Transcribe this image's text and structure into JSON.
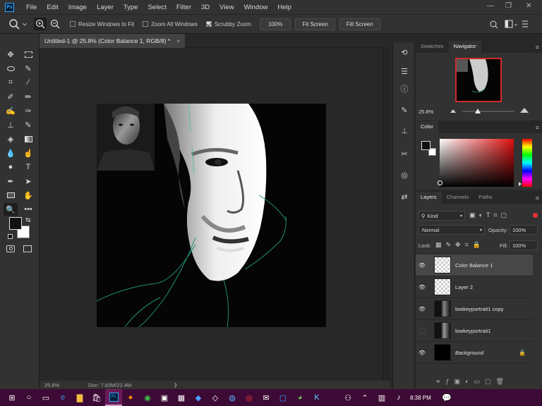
{
  "app": {
    "logo": "Ps"
  },
  "menu": [
    "File",
    "Edit",
    "Image",
    "Layer",
    "Type",
    "Select",
    "Filter",
    "3D",
    "View",
    "Window",
    "Help"
  ],
  "options": {
    "resize_windows": "Resize Windows to Fit",
    "zoom_all": "Zoom All Windows",
    "scrubby": "Scrubby Zoom",
    "zoom_value": "100%",
    "fit_screen": "Fit Screen",
    "fill_screen": "Fill Screen"
  },
  "document": {
    "tab_title": "Untitled-1 @ 25.8% (Color Balance 1, RGB/8) *",
    "close": "×"
  },
  "status": {
    "zoom": "25.8%",
    "doc": "Doc: 7.83M/22.4M",
    "arrow": "❯"
  },
  "navigator": {
    "tabs": [
      "Swatches",
      "Navigator"
    ],
    "zoom": "25.8%",
    "zoom_slider_fraction": 0.3
  },
  "color_panel": {
    "tab": "Color",
    "foreground": "#111111",
    "background": "#ffffff",
    "hue": "#e01010"
  },
  "layers_panel": {
    "tabs": [
      "Layers",
      "Channels",
      "Paths"
    ],
    "filter": "Kind",
    "blend_mode": "Normal",
    "opacity_label": "Opacity:",
    "opacity": "100%",
    "lock_label": "Lock:",
    "fill_label": "Fill:",
    "fill": "100%",
    "layers": [
      {
        "name": "Color Balance 1",
        "visible": true,
        "selected": true
      },
      {
        "name": "Layer 2",
        "visible": true
      },
      {
        "name": "lowkeyportrait1 copy",
        "visible": true
      },
      {
        "name": "lowkeyportrait1",
        "visible": false
      },
      {
        "name": "Background",
        "visible": true,
        "italic": true,
        "locked": true
      }
    ]
  },
  "taskbar": {
    "time": "8:38 PM",
    "notification": "💬"
  },
  "colors": {
    "accent": "#31a8ff",
    "taskbar": "#3d0a35",
    "highlight": "#d12a2a"
  }
}
